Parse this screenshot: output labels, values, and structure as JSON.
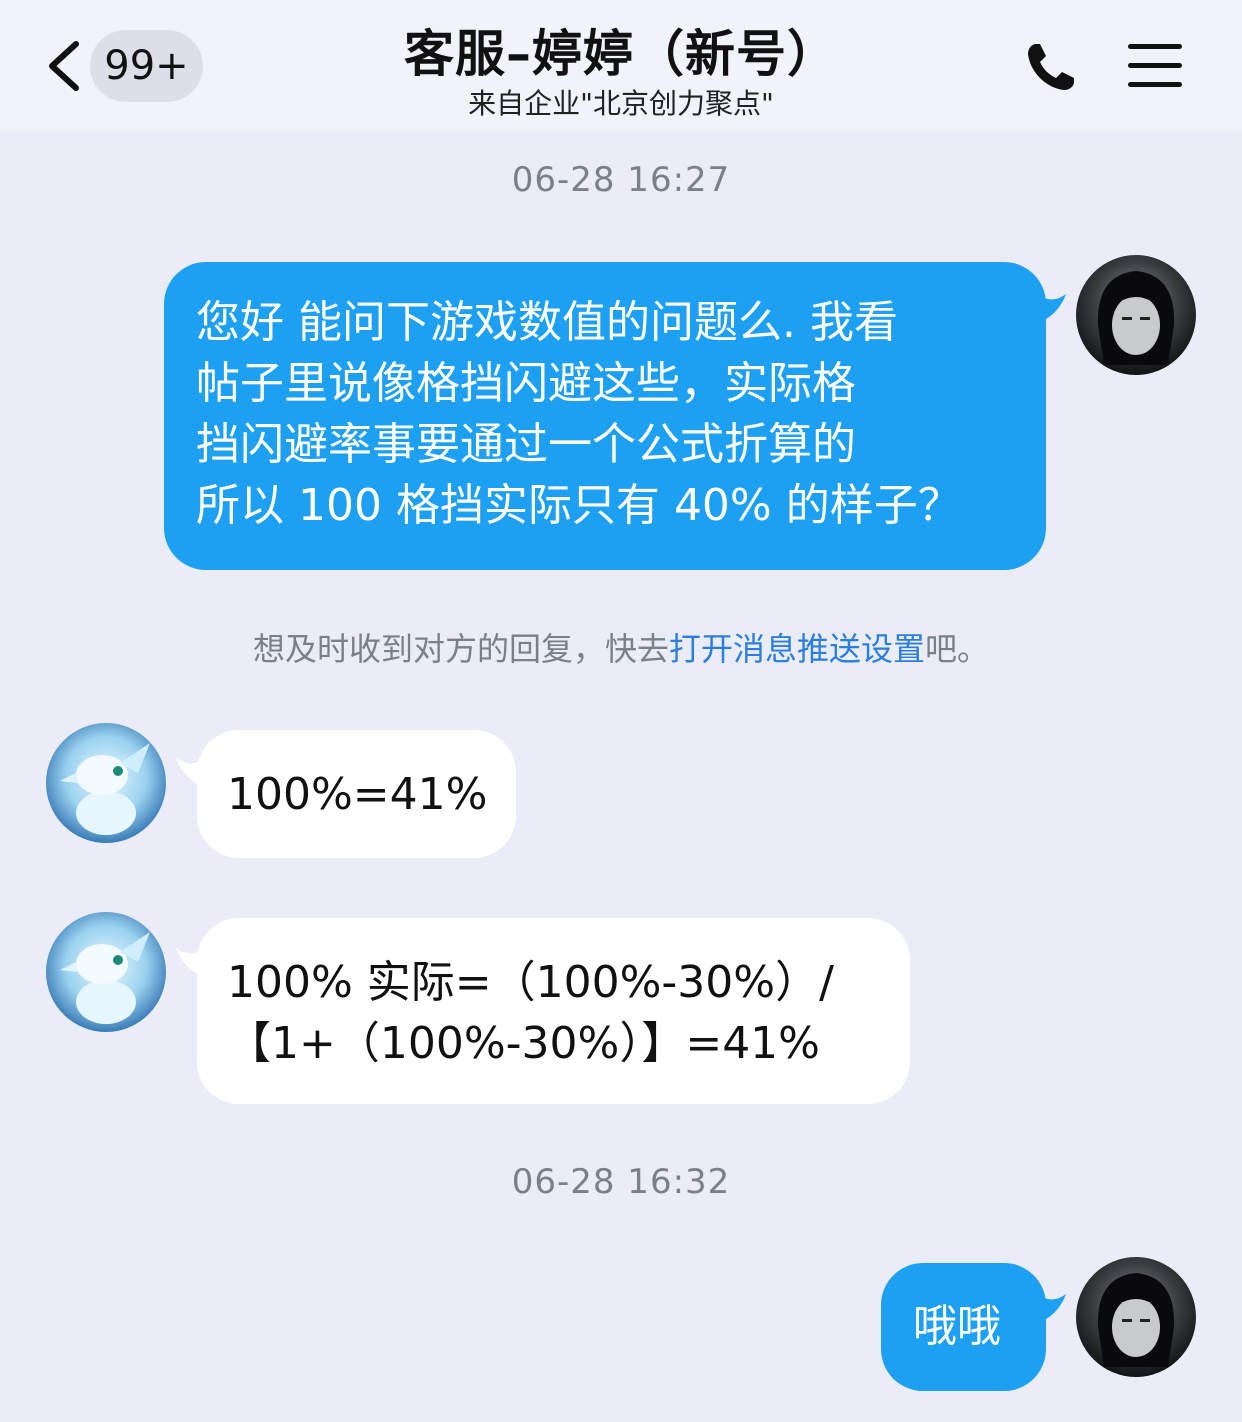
{
  "header": {
    "unread_badge": "99+",
    "title": "客服–婷婷（新号）",
    "subtitle": "来自企业\"北京创力聚点\""
  },
  "messages": [
    {
      "type": "timestamp",
      "text": "06-28 16:27"
    },
    {
      "type": "outgoing",
      "lines": [
        "您好 能问下游戏数值的问题么. 我看",
        "帖子里说像格挡闪避这些，实际格",
        "挡闪避率事要通过一个公式折算的",
        "所以 100 格挡实际只有 40% 的样子？"
      ]
    },
    {
      "type": "notice",
      "prefix": "想及时收到对方的回复，快去",
      "link": "打开消息推送设置",
      "suffix": "吧。"
    },
    {
      "type": "incoming",
      "lines": [
        "100%=41%"
      ]
    },
    {
      "type": "incoming",
      "lines": [
        "100% 实际=（100%-30%）/",
        "【1+（100%-30%）】=41%"
      ]
    },
    {
      "type": "timestamp",
      "text": "06-28 16:32"
    },
    {
      "type": "outgoing",
      "lines": [
        "哦哦"
      ]
    }
  ],
  "colors": {
    "background": "#eaedf8",
    "outgoing_bubble": "#1ea0f2",
    "incoming_bubble": "#ffffff",
    "link": "#2c7de0"
  },
  "icons": {
    "back": "chevron-left-icon",
    "call": "phone-icon",
    "menu": "hamburger-menu-icon"
  }
}
